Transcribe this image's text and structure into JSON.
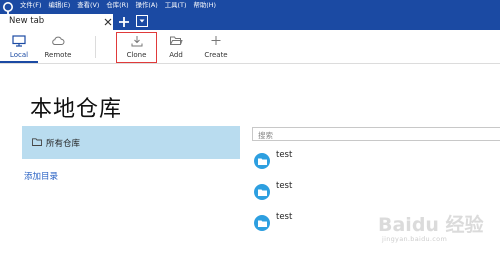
{
  "app": {
    "logo_icon": "sourcetree-logo-icon",
    "accent_color": "#1b4aa3"
  },
  "menu": {
    "items": [
      "文件(F)",
      "编辑(E)",
      "查看(V)",
      "仓库(R)",
      "操作(A)",
      "工具(T)",
      "帮助(H)"
    ]
  },
  "tabs": {
    "active_label": "New tab",
    "close_icon": "close-icon",
    "new_tab_icon": "plus-icon",
    "dropdown_icon": "chevron-down-icon"
  },
  "toolbar": {
    "local_label": "Local",
    "remote_label": "Remote",
    "clone_label": "Clone",
    "add_label": "Add",
    "create_label": "Create",
    "highlight_color": "#e03a3a"
  },
  "page": {
    "title": "本地仓库"
  },
  "sidebar": {
    "all_repos_label": "所有仓库",
    "add_folder_label": "添加目录",
    "selected_color": "#b9dcef"
  },
  "search": {
    "placeholder": "搜索"
  },
  "repos": [
    {
      "name": "test"
    },
    {
      "name": "test"
    },
    {
      "name": "test"
    }
  ],
  "watermark": {
    "brand": "Baidu 经验",
    "url": "jingyan.baidu.com"
  }
}
